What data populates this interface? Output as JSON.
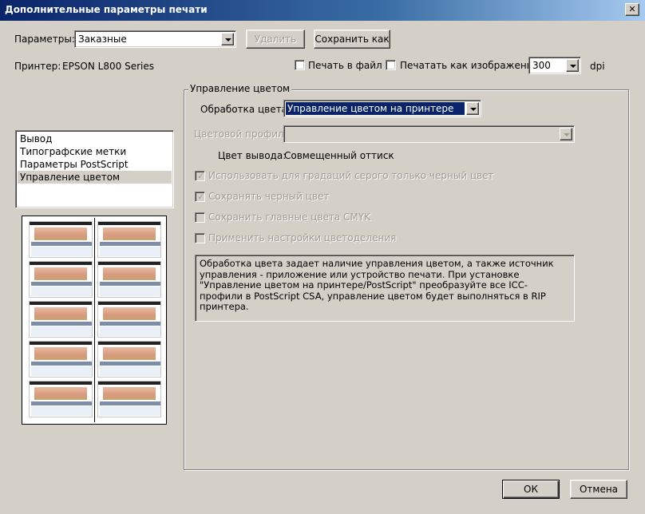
{
  "window": {
    "title": "Дополнительные параметры печати",
    "close_glyph": "✕"
  },
  "presets": {
    "label": "Параметры:",
    "value": "Заказные",
    "delete_label": "Удалить",
    "save_as_label": "Сохранить как"
  },
  "printer": {
    "label": "Принтер:",
    "name": "EPSON L800 Series",
    "print_to_file_label": "Печать в файл",
    "print_to_file_checked": false,
    "print_as_image_label": "Печатать как изображение",
    "print_as_image_checked": false,
    "dpi_value": "300",
    "dpi_unit": "dpi"
  },
  "sections": {
    "items": [
      {
        "label": "Вывод",
        "selected": false
      },
      {
        "label": "Типографские метки",
        "selected": false
      },
      {
        "label": "Параметры PostScript",
        "selected": false
      },
      {
        "label": "Управление цветом",
        "selected": true
      }
    ]
  },
  "color_management": {
    "group_title": "Управление цветом",
    "color_handling_label": "Обработка цвета:",
    "color_handling_value": "Управление цветом на принтере",
    "color_profile_label": "Цветовой профиль:",
    "color_profile_value": "",
    "output_color_label": "Цвет вывода:",
    "output_color_value": "Совмещенный оттиск",
    "options": [
      {
        "label": "Использовать для градаций серого только черный цвет",
        "checked": true,
        "enabled": false
      },
      {
        "label": "Сохранять черный цвет",
        "checked": true,
        "enabled": false
      },
      {
        "label": "Сохранить главные цвета CMYK",
        "checked": false,
        "enabled": false
      },
      {
        "label": "Применить настройки цветоделения",
        "checked": false,
        "enabled": false
      }
    ],
    "description": "Обработка цвета задает наличие управления цветом, а также источник управления - приложение или устройство печати. При установке \"Управление цветом на принтере/PostScript\" преобразуйте все ICC-профили в PostScript CSA, управление цветом будет выполняться в RIP принтера."
  },
  "footer": {
    "ok_label": "ОК",
    "cancel_label": "Отмена"
  },
  "colors": {
    "titlebar_start": "#0a246a",
    "titlebar_end": "#a6caf0",
    "dialog_bg": "#d4d0c8",
    "selection": "#0a246a"
  }
}
